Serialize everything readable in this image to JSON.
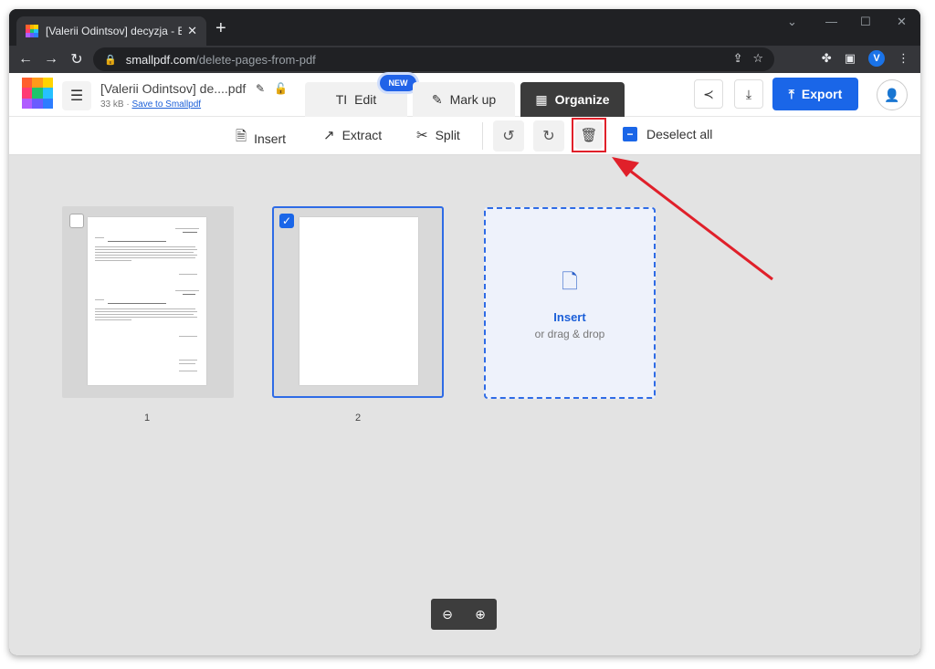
{
  "browser": {
    "tab_title": "[Valerii Odintsov] decyzja - Edit P",
    "tab_close": "✕",
    "new_tab": "+",
    "url_host": "smallpdf.com",
    "url_path": "/delete-pages-from-pdf",
    "profile_initial": "V"
  },
  "header": {
    "doc_name": "[Valerii Odintsov] de....pdf",
    "doc_size": "33 kB",
    "meta_sep": "·",
    "save_link": "Save to Smallpdf",
    "tabs": {
      "edit": "Edit",
      "new_badge": "NEW",
      "markup": "Mark up",
      "organize": "Organize"
    },
    "export_label": "Export"
  },
  "organize_toolbar": {
    "insert": "Insert",
    "extract": "Extract",
    "split": "Split",
    "deselect_all": "Deselect all"
  },
  "pages": [
    {
      "number": "1",
      "selected": false
    },
    {
      "number": "2",
      "selected": true
    }
  ],
  "insert_card": {
    "label": "Insert",
    "sublabel": "or drag & drop"
  },
  "colors": {
    "brand_blue": "#1a66e8",
    "highlight_red": "#e0202a"
  },
  "icons": [
    "hamburger-icon",
    "pencil-icon",
    "lock-icon",
    "share-icon",
    "download-icon",
    "upload-icon",
    "user-icon",
    "insert-icon",
    "extract-icon",
    "scissors-icon",
    "rotate-left-icon",
    "rotate-right-icon",
    "trash-icon",
    "zoom-out-icon",
    "zoom-in-icon"
  ]
}
